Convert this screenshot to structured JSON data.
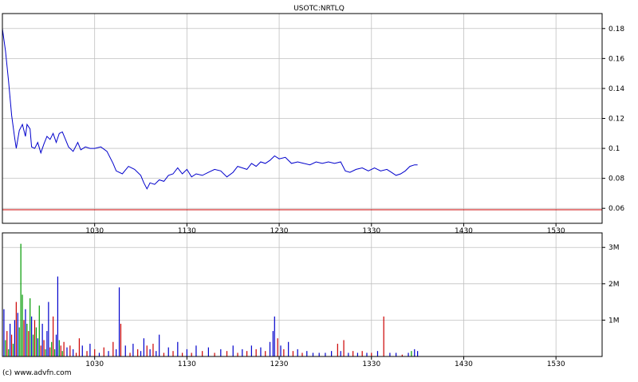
{
  "chart_data": [
    {
      "type": "line",
      "title": "USOTC:NRTLQ",
      "xlabel": "",
      "ylabel": "",
      "x_ticks": [
        "1030",
        "1130",
        "1230",
        "1330",
        "1430",
        "1530"
      ],
      "y_ticks": [
        "0.06",
        "0.08",
        "0.1",
        "0.12",
        "0.14",
        "0.16",
        "0.18"
      ],
      "ylim": [
        0.05,
        0.19
      ],
      "xlim": [
        "09:30",
        "16:00"
      ],
      "grid": true,
      "reference_line": {
        "value": 0.05,
        "color": "#cc0000"
      },
      "series": [
        {
          "color": "#0000cc",
          "points": [
            [
              "09:30",
              0.18
            ],
            [
              "09:32",
              0.165
            ],
            [
              "09:34",
              0.145
            ],
            [
              "09:36",
              0.122
            ],
            [
              "09:38",
              0.107
            ],
            [
              "09:39",
              0.1
            ],
            [
              "09:41",
              0.112
            ],
            [
              "09:43",
              0.116
            ],
            [
              "09:45",
              0.108
            ],
            [
              "09:46",
              0.116
            ],
            [
              "09:48",
              0.113
            ],
            [
              "09:49",
              0.101
            ],
            [
              "09:51",
              0.1
            ],
            [
              "09:53",
              0.104
            ],
            [
              "09:55",
              0.097
            ],
            [
              "09:57",
              0.103
            ],
            [
              "09:59",
              0.108
            ],
            [
              "10:01",
              0.106
            ],
            [
              "10:03",
              0.11
            ],
            [
              "10:05",
              0.104
            ],
            [
              "10:07",
              0.11
            ],
            [
              "10:09",
              0.111
            ],
            [
              "10:11",
              0.106
            ],
            [
              "10:13",
              0.101
            ],
            [
              "10:16",
              0.098
            ],
            [
              "10:19",
              0.104
            ],
            [
              "10:21",
              0.099
            ],
            [
              "10:24",
              0.101
            ],
            [
              "10:27",
              0.1
            ],
            [
              "10:30",
              0.1
            ],
            [
              "10:34",
              0.101
            ],
            [
              "10:38",
              0.098
            ],
            [
              "10:42",
              0.09
            ],
            [
              "10:44",
              0.085
            ],
            [
              "10:48",
              0.083
            ],
            [
              "10:52",
              0.088
            ],
            [
              "10:56",
              0.086
            ],
            [
              "11:00",
              0.082
            ],
            [
              "11:02",
              0.077
            ],
            [
              "11:04",
              0.073
            ],
            [
              "11:06",
              0.077
            ],
            [
              "11:09",
              0.076
            ],
            [
              "11:12",
              0.079
            ],
            [
              "11:15",
              0.078
            ],
            [
              "11:18",
              0.082
            ],
            [
              "11:21",
              0.083
            ],
            [
              "11:24",
              0.087
            ],
            [
              "11:27",
              0.083
            ],
            [
              "11:30",
              0.086
            ],
            [
              "11:33",
              0.081
            ],
            [
              "11:36",
              0.083
            ],
            [
              "11:40",
              0.082
            ],
            [
              "11:44",
              0.084
            ],
            [
              "11:48",
              0.086
            ],
            [
              "11:52",
              0.085
            ],
            [
              "11:56",
              0.081
            ],
            [
              "12:00",
              0.084
            ],
            [
              "12:03",
              0.088
            ],
            [
              "12:06",
              0.087
            ],
            [
              "12:09",
              0.086
            ],
            [
              "12:12",
              0.09
            ],
            [
              "12:15",
              0.088
            ],
            [
              "12:18",
              0.091
            ],
            [
              "12:21",
              0.09
            ],
            [
              "12:24",
              0.092
            ],
            [
              "12:27",
              0.095
            ],
            [
              "12:30",
              0.093
            ],
            [
              "12:34",
              0.094
            ],
            [
              "12:38",
              0.09
            ],
            [
              "12:42",
              0.091
            ],
            [
              "12:46",
              0.09
            ],
            [
              "12:50",
              0.089
            ],
            [
              "12:54",
              0.091
            ],
            [
              "12:58",
              0.09
            ],
            [
              "13:02",
              0.091
            ],
            [
              "13:06",
              0.09
            ],
            [
              "13:10",
              0.091
            ],
            [
              "13:13",
              0.085
            ],
            [
              "13:16",
              0.084
            ],
            [
              "13:20",
              0.086
            ],
            [
              "13:24",
              0.087
            ],
            [
              "13:28",
              0.085
            ],
            [
              "13:32",
              0.087
            ],
            [
              "13:36",
              0.085
            ],
            [
              "13:40",
              0.086
            ],
            [
              "13:43",
              0.084
            ],
            [
              "13:46",
              0.082
            ],
            [
              "13:49",
              0.083
            ],
            [
              "13:52",
              0.085
            ],
            [
              "13:55",
              0.088
            ],
            [
              "13:58",
              0.089
            ],
            [
              "14:00",
              0.089
            ]
          ]
        }
      ]
    },
    {
      "type": "bar",
      "title": "",
      "y_ticks": [
        "1M",
        "2M",
        "3M"
      ],
      "ylim": [
        0,
        3400000
      ],
      "x_ticks": [
        "1030",
        "1130",
        "1230",
        "1330",
        "1430",
        "1530"
      ],
      "grid": true,
      "series": [
        {
          "name": "",
          "bars": [
            [
              "09:31",
              1300000,
              "#0000cc"
            ],
            [
              "09:32",
              450000,
              "#009900"
            ],
            [
              "09:33",
              700000,
              "#cc0000"
            ],
            [
              "09:34",
              200000,
              "#009900"
            ],
            [
              "09:35",
              900000,
              "#0000cc"
            ],
            [
              "09:36",
              600000,
              "#cc0000"
            ],
            [
              "09:37",
              350000,
              "#009900"
            ],
            [
              "09:38",
              1000000,
              "#0000cc"
            ],
            [
              "09:39",
              1500000,
              "#cc0000"
            ],
            [
              "09:40",
              1200000,
              "#0000cc"
            ],
            [
              "09:41",
              800000,
              "#009900"
            ],
            [
              "09:42",
              3100000,
              "#009900"
            ],
            [
              "09:43",
              1700000,
              "#009900"
            ],
            [
              "09:44",
              1000000,
              "#cc0000"
            ],
            [
              "09:45",
              1300000,
              "#0000cc"
            ],
            [
              "09:46",
              900000,
              "#009900"
            ],
            [
              "09:47",
              700000,
              "#cc0000"
            ],
            [
              "09:48",
              1600000,
              "#009900"
            ],
            [
              "09:49",
              1100000,
              "#0000cc"
            ],
            [
              "09:50",
              600000,
              "#009900"
            ],
            [
              "09:51",
              1000000,
              "#cc0000"
            ],
            [
              "09:52",
              800000,
              "#009900"
            ],
            [
              "09:53",
              500000,
              "#0000cc"
            ],
            [
              "09:54",
              1400000,
              "#009900"
            ],
            [
              "09:55",
              300000,
              "#cc0000"
            ],
            [
              "09:56",
              900000,
              "#0000cc"
            ],
            [
              "09:57",
              450000,
              "#cc0000"
            ],
            [
              "09:58",
              200000,
              "#009900"
            ],
            [
              "09:59",
              700000,
              "#0000cc"
            ],
            [
              "10:00",
              1500000,
              "#0000cc"
            ],
            [
              "10:01",
              250000,
              "#cc0000"
            ],
            [
              "10:02",
              400000,
              "#009900"
            ],
            [
              "10:03",
              1100000,
              "#cc0000"
            ],
            [
              "10:04",
              200000,
              "#009900"
            ],
            [
              "10:05",
              600000,
              "#0000cc"
            ],
            [
              "10:06",
              2200000,
              "#0000cc"
            ],
            [
              "10:07",
              450000,
              "#009900"
            ],
            [
              "10:08",
              300000,
              "#cc0000"
            ],
            [
              "10:09",
              150000,
              "#009900"
            ],
            [
              "10:10",
              400000,
              "#cc0000"
            ],
            [
              "10:12",
              250000,
              "#0000cc"
            ],
            [
              "10:14",
              300000,
              "#cc0000"
            ],
            [
              "10:16",
              200000,
              "#0000cc"
            ],
            [
              "10:18",
              100000,
              "#cc0000"
            ],
            [
              "10:20",
              500000,
              "#cc0000"
            ],
            [
              "10:22",
              300000,
              "#0000cc"
            ],
            [
              "10:25",
              150000,
              "#cc0000"
            ],
            [
              "10:27",
              350000,
              "#0000cc"
            ],
            [
              "10:30",
              200000,
              "#cc0000"
            ],
            [
              "10:33",
              100000,
              "#0000cc"
            ],
            [
              "10:36",
              250000,
              "#cc0000"
            ],
            [
              "10:39",
              150000,
              "#0000cc"
            ],
            [
              "10:42",
              400000,
              "#cc0000"
            ],
            [
              "10:44",
              200000,
              "#0000cc"
            ],
            [
              "10:46",
              1900000,
              "#0000cc"
            ],
            [
              "10:47",
              900000,
              "#cc0000"
            ],
            [
              "10:50",
              300000,
              "#0000cc"
            ],
            [
              "10:53",
              100000,
              "#cc0000"
            ],
            [
              "10:55",
              350000,
              "#0000cc"
            ],
            [
              "10:58",
              200000,
              "#cc0000"
            ],
            [
              "11:00",
              150000,
              "#0000cc"
            ],
            [
              "11:02",
              500000,
              "#0000cc"
            ],
            [
              "11:04",
              300000,
              "#cc0000"
            ],
            [
              "11:06",
              200000,
              "#0000cc"
            ],
            [
              "11:08",
              350000,
              "#cc0000"
            ],
            [
              "11:10",
              150000,
              "#0000cc"
            ],
            [
              "11:12",
              600000,
              "#0000cc"
            ],
            [
              "11:15",
              100000,
              "#cc0000"
            ],
            [
              "11:18",
              250000,
              "#0000cc"
            ],
            [
              "11:21",
              150000,
              "#cc0000"
            ],
            [
              "11:24",
              400000,
              "#0000cc"
            ],
            [
              "11:27",
              100000,
              "#cc0000"
            ],
            [
              "11:30",
              200000,
              "#0000cc"
            ],
            [
              "11:33",
              100000,
              "#cc0000"
            ],
            [
              "11:36",
              300000,
              "#0000cc"
            ],
            [
              "11:40",
              150000,
              "#cc0000"
            ],
            [
              "11:44",
              250000,
              "#0000cc"
            ],
            [
              "11:48",
              100000,
              "#cc0000"
            ],
            [
              "11:52",
              200000,
              "#0000cc"
            ],
            [
              "11:56",
              150000,
              "#cc0000"
            ],
            [
              "12:00",
              300000,
              "#0000cc"
            ],
            [
              "12:03",
              100000,
              "#cc0000"
            ],
            [
              "12:06",
              200000,
              "#0000cc"
            ],
            [
              "12:09",
              150000,
              "#cc0000"
            ],
            [
              "12:12",
              300000,
              "#0000cc"
            ],
            [
              "12:15",
              200000,
              "#cc0000"
            ],
            [
              "12:18",
              250000,
              "#0000cc"
            ],
            [
              "12:21",
              150000,
              "#cc0000"
            ],
            [
              "12:24",
              400000,
              "#0000cc"
            ],
            [
              "12:26",
              700000,
              "#0000cc"
            ],
            [
              "12:27",
              1100000,
              "#0000cc"
            ],
            [
              "12:29",
              500000,
              "#cc0000"
            ],
            [
              "12:31",
              300000,
              "#0000cc"
            ],
            [
              "12:33",
              200000,
              "#cc0000"
            ],
            [
              "12:36",
              400000,
              "#0000cc"
            ],
            [
              "12:39",
              150000,
              "#cc0000"
            ],
            [
              "12:42",
              200000,
              "#0000cc"
            ],
            [
              "12:45",
              100000,
              "#cc0000"
            ],
            [
              "12:48",
              150000,
              "#0000cc"
            ],
            [
              "12:52",
              100000,
              "#0000cc"
            ],
            [
              "12:56",
              100000,
              "#0000cc"
            ],
            [
              "13:00",
              100000,
              "#0000cc"
            ],
            [
              "13:04",
              150000,
              "#0000cc"
            ],
            [
              "13:08",
              350000,
              "#cc0000"
            ],
            [
              "13:10",
              150000,
              "#0000cc"
            ],
            [
              "13:12",
              450000,
              "#cc0000"
            ],
            [
              "13:15",
              100000,
              "#0000cc"
            ],
            [
              "13:18",
              150000,
              "#cc0000"
            ],
            [
              "13:21",
              100000,
              "#0000cc"
            ],
            [
              "13:24",
              150000,
              "#cc0000"
            ],
            [
              "13:27",
              100000,
              "#0000cc"
            ],
            [
              "13:30",
              100000,
              "#cc0000"
            ],
            [
              "13:34",
              150000,
              "#0000cc"
            ],
            [
              "13:38",
              1100000,
              "#cc0000"
            ],
            [
              "13:42",
              100000,
              "#0000cc"
            ],
            [
              "13:46",
              100000,
              "#0000cc"
            ],
            [
              "13:50",
              50000,
              "#cc0000"
            ],
            [
              "13:54",
              100000,
              "#0000cc"
            ],
            [
              "13:56",
              150000,
              "#009900"
            ],
            [
              "13:58",
              200000,
              "#0000cc"
            ],
            [
              "14:00",
              150000,
              "#0000cc"
            ]
          ]
        }
      ]
    }
  ],
  "footer": {
    "copyright": "(c) www.advfn.com"
  },
  "colors": {
    "price_line": "#0000cc",
    "reference_line": "#cc0000",
    "grid": "#c0c0c0",
    "axis": "#000000"
  }
}
